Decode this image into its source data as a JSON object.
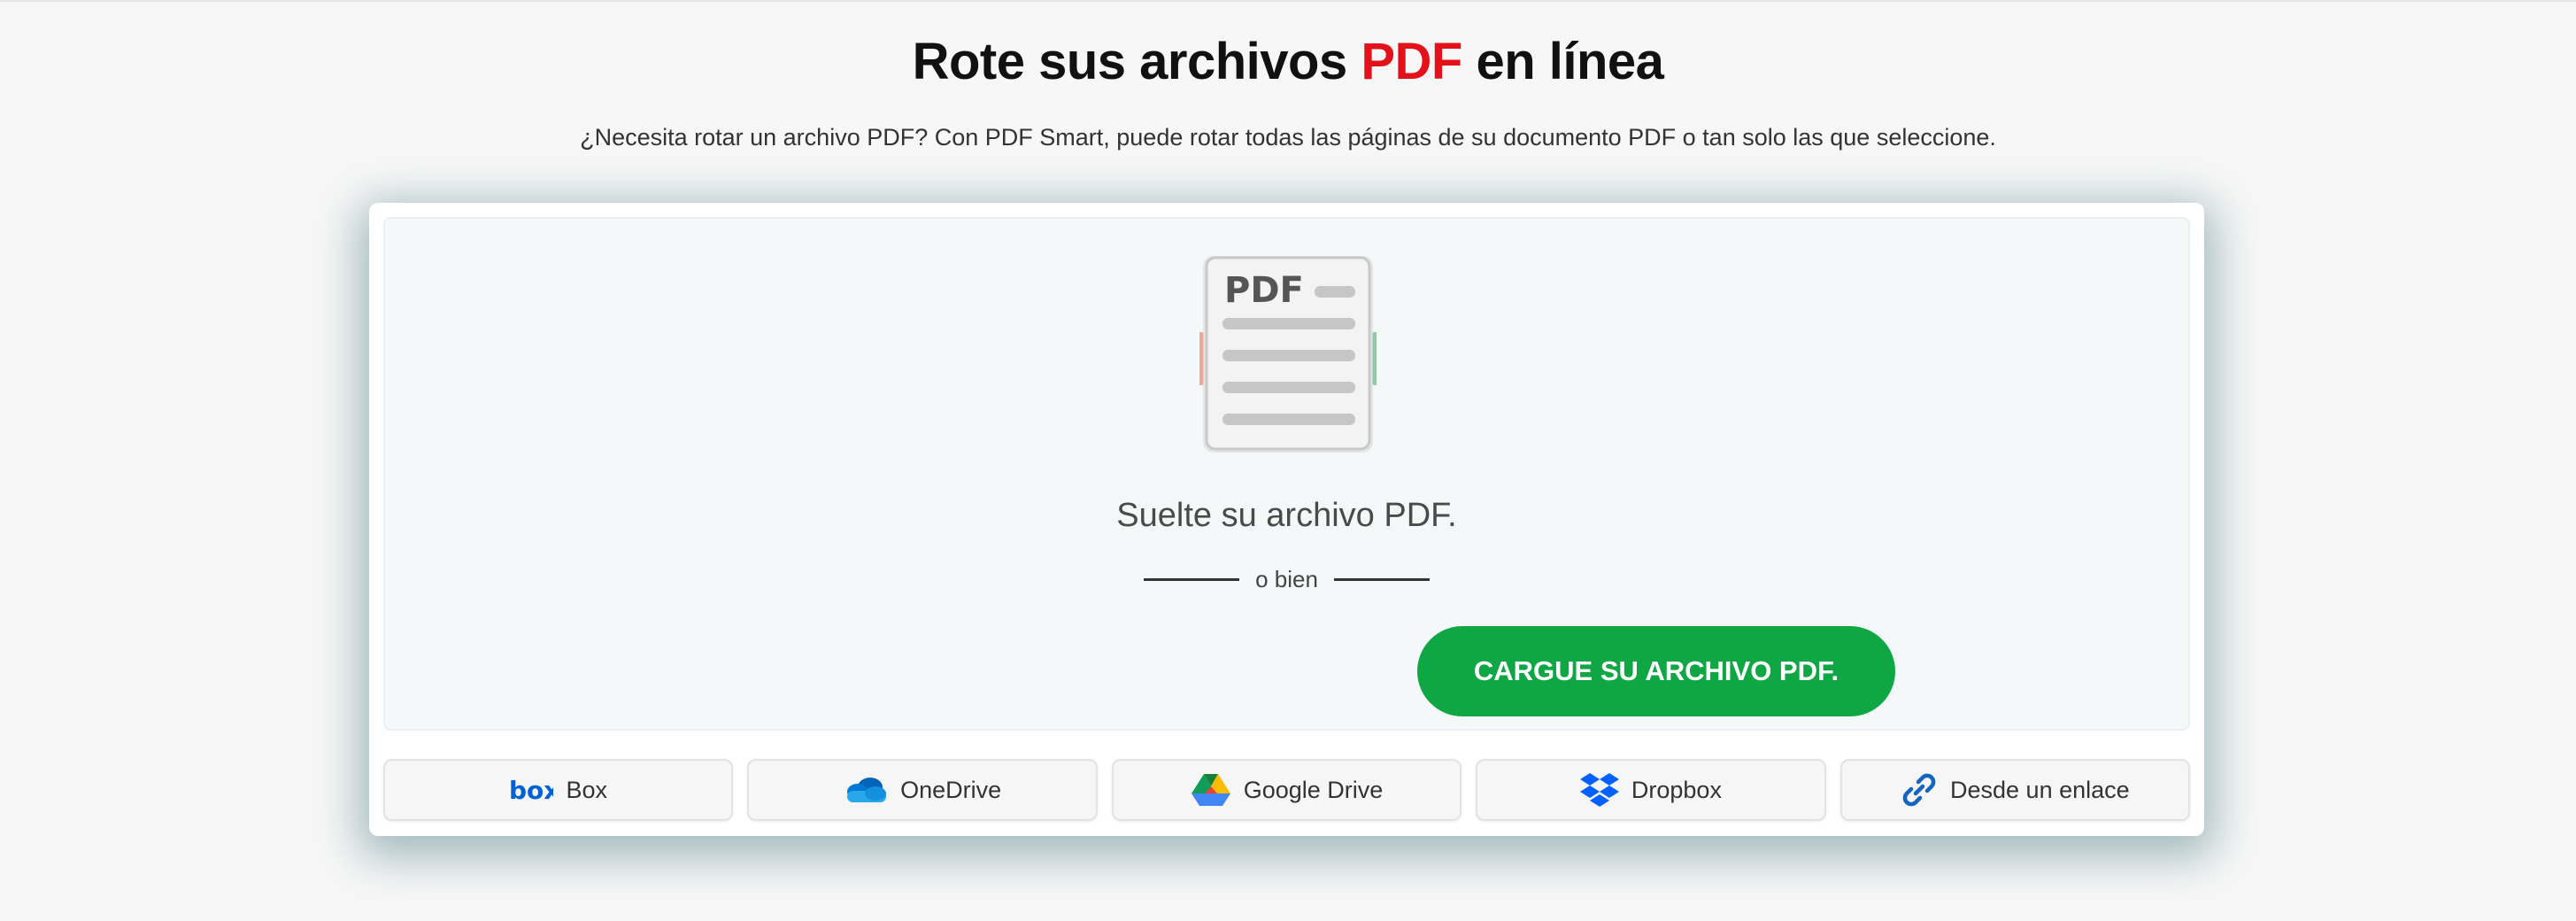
{
  "header": {
    "title_part1": "Rote sus archivos ",
    "title_accent": "PDF",
    "title_part2": " en línea",
    "subtitle": "¿Necesita rotar un archivo PDF? Con PDF Smart, puede rotar todas las páginas de su documento PDF o tan solo las que seleccione."
  },
  "dropzone": {
    "illustration_label": "PDF",
    "drop_text": "Suelte su archivo PDF.",
    "or_text": "o bien",
    "upload_label": "CARGUE SU ARCHIVO PDF."
  },
  "sources": [
    {
      "label": "Box",
      "icon": "box-icon"
    },
    {
      "label": "OneDrive",
      "icon": "onedrive-icon"
    },
    {
      "label": "Google Drive",
      "icon": "google-drive-icon"
    },
    {
      "label": "Dropbox",
      "icon": "dropbox-icon"
    },
    {
      "label": "Desde un enlace",
      "icon": "link-icon"
    }
  ],
  "colors": {
    "accent_red": "#e3111a",
    "upload_green": "#0ea743",
    "background": "#f7f7f7"
  }
}
